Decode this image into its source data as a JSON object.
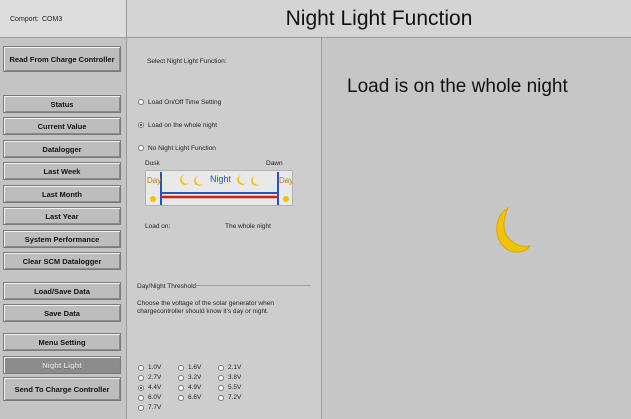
{
  "comport": {
    "label": "Comport:",
    "value": "COM3"
  },
  "title": "Night Light Function",
  "sidebar": {
    "read_button": "Read From Charge Controller",
    "items": [
      {
        "label": "Status"
      },
      {
        "label": "Current Value"
      },
      {
        "label": "Datalogger"
      },
      {
        "label": "Last Week"
      },
      {
        "label": "Last Month"
      },
      {
        "label": "Last Year"
      },
      {
        "label": "System Performance"
      },
      {
        "label": "Clear SCM Datalogger"
      }
    ],
    "data_items": [
      {
        "label": "Load/Save Data"
      },
      {
        "label": "Save Data"
      }
    ],
    "setting_items": [
      {
        "label": "Menu Setting"
      },
      {
        "label": "Night Light",
        "active": true
      },
      {
        "label": "Send To Charge Controller"
      }
    ]
  },
  "night_light": {
    "select_label": "Select Night Light Function:",
    "options": [
      {
        "label": "Load On/Off Time Setting",
        "selected": false
      },
      {
        "label": "Load on the whole night",
        "selected": true
      },
      {
        "label": "No Night Light Function",
        "selected": false
      }
    ],
    "dusk_label": "Dusk",
    "dawn_label": "Dawn",
    "day_label": "Day",
    "night_label": "Night",
    "load_on_label": "Load on:",
    "load_on_value": "The whole night"
  },
  "threshold": {
    "group_label": "Day/Night Threshold",
    "description": "Choose the voltage of the solar generator when chargecontroller should know it's day or night.",
    "voltages": [
      "1.0V",
      "1.6V",
      "2.1V",
      "2.7V",
      "3.2V",
      "3.8V",
      "4.4V",
      "4.9V",
      "5.5V",
      "6.0V",
      "6.6V",
      "7.2V",
      "7.7V"
    ],
    "selected": "4.4V"
  },
  "display": {
    "message": "Load is on the whole night",
    "icon": "moon-icon",
    "moon_color": "#f2c200"
  }
}
